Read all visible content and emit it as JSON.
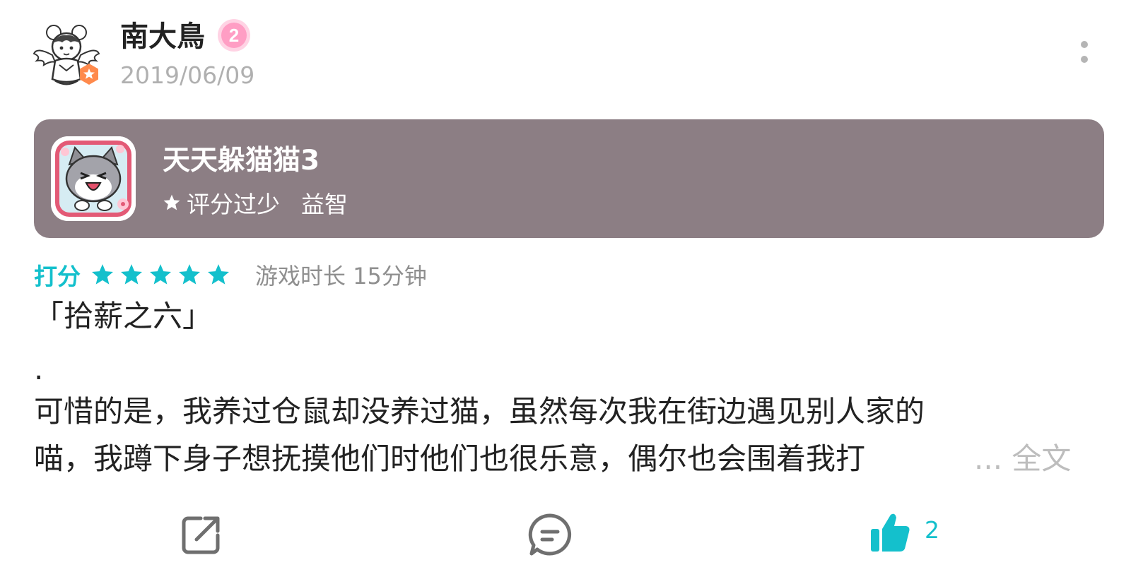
{
  "user": {
    "name": "南大鳥",
    "level": "2",
    "date": "2019/06/09",
    "avatar_icon": "anime-girl-avatar",
    "badge_icon": "verified-star-badge-icon"
  },
  "game": {
    "title": "天天躲猫猫3",
    "rating_text": "评分过少",
    "genre": "益智",
    "icon": "cartoon-cat-app-icon",
    "card_color": "#8c7e84"
  },
  "review": {
    "rating_label": "打分",
    "stars": 5,
    "max_stars": 5,
    "playtime": "游戏时长 15分钟",
    "heading": "「拾薪之六」",
    "dot": ".",
    "lines": [
      "可惜的是，我养过仓鼠却没养过猫，虽然每次我在街边遇见别人家的",
      "喵，我蹲下身子想抚摸他们时他们也很乐意，偶尔也会围着我打"
    ],
    "read_more": "... 全文"
  },
  "actions": {
    "like_count": "2"
  },
  "colors": {
    "accent": "#14c0cc",
    "text": "#222222",
    "muted": "#b0b0b0",
    "level_badge": "#ff9ec4",
    "avatar_badge": "#ff8a4c"
  }
}
